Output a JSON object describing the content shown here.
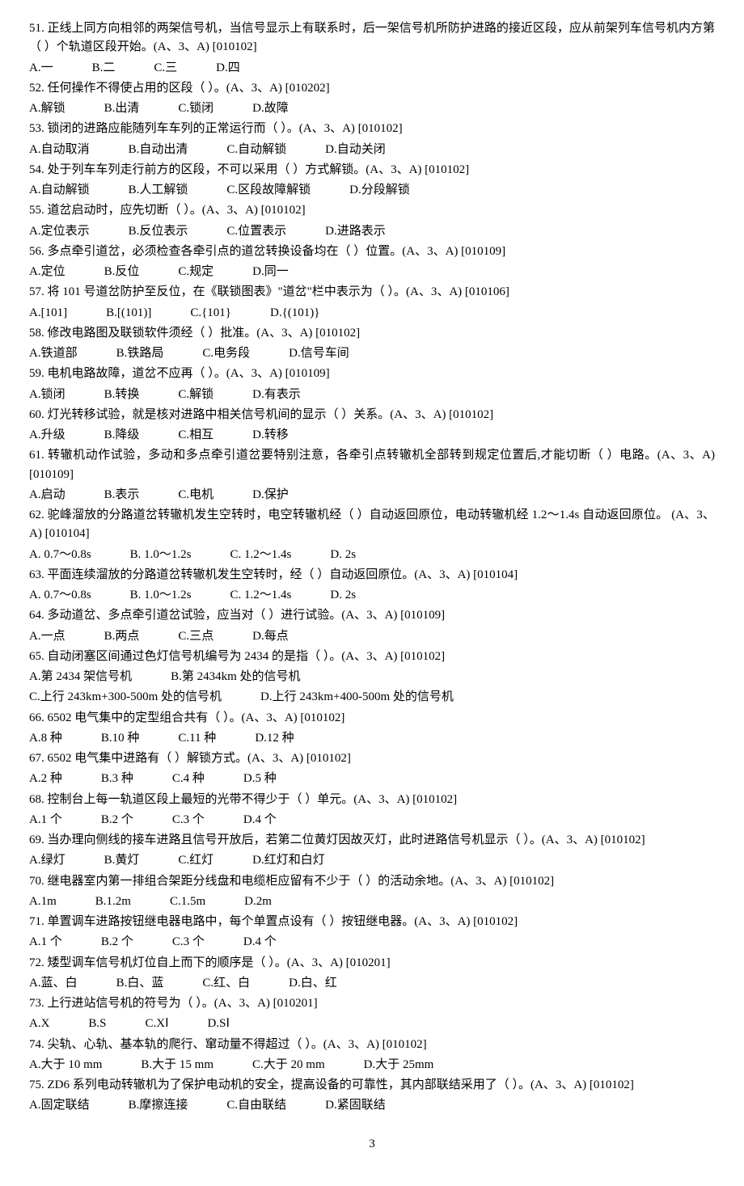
{
  "page_number": "3",
  "questions": [
    {
      "num": "51",
      "text": "正线上同方向相邻的两架信号机，当信号显示上有联系时，后一架信号机所防护进路的接近区段，应从前架列车信号机内方第（    ）个轨道区段开始。(A、3、A)  [010102]",
      "opts": [
        "A.一",
        "B.二",
        "C.三",
        "D.四"
      ]
    },
    {
      "num": "52",
      "text": "任何操作不得使占用的区段（    ）。(A、3、A)  [010202]",
      "opts": [
        "A.解锁",
        "B.出清",
        "C.锁闭",
        "D.故障"
      ]
    },
    {
      "num": "53",
      "text": "锁闭的进路应能随列车车列的正常运行而（    ）。(A、3、A)  [010102]",
      "opts": [
        "A.自动取消",
        "B.自动出清",
        "C.自动解锁",
        "D.自动关闭"
      ]
    },
    {
      "num": "54",
      "text": "处于列车车列走行前方的区段，不可以采用（    ）方式解锁。(A、3、A)  [010102]",
      "opts": [
        "A.自动解锁",
        "B.人工解锁",
        "C.区段故障解锁",
        "D.分段解锁"
      ]
    },
    {
      "num": "55",
      "text": "道岔启动时，应先切断（    ）。(A、3、A)  [010102]",
      "opts": [
        "A.定位表示",
        "B.反位表示",
        "C.位置表示",
        "D.进路表示"
      ]
    },
    {
      "num": "56",
      "text": "多点牵引道岔，必须检查各牵引点的道岔转换设备均在（    ）位置。(A、3、A)  [010109]",
      "opts": [
        "A.定位",
        "B.反位",
        "C.规定",
        "D.同一"
      ]
    },
    {
      "num": "57",
      "text": "将 101 号道岔防护至反位，在《联锁图表》\"道岔\"栏中表示为（    ）。(A、3、A)  [010106]",
      "opts": [
        "A.[101]",
        "B.[(101)]",
        "C.{101}",
        "D.{(101)}"
      ]
    },
    {
      "num": "58",
      "text": "修改电路图及联锁软件须经（    ）批准。(A、3、A)  [010102]",
      "opts": [
        "A.铁道部",
        "B.铁路局",
        "C.电务段",
        "D.信号车间"
      ]
    },
    {
      "num": "59",
      "text": "电机电路故障，道岔不应再（    ）。(A、3、A)  [010109]",
      "opts": [
        "A.锁闭",
        "B.转换",
        "C.解锁",
        "D.有表示"
      ]
    },
    {
      "num": "60",
      "text": "灯光转移试验，就是核对进路中相关信号机间的显示（    ）关系。(A、3、A)  [010102]",
      "opts": [
        "A.升级",
        "B.降级",
        "C.相互",
        "D.转移"
      ]
    },
    {
      "num": "61",
      "text": "转辙机动作试验，多动和多点牵引道岔要特别注意，各牵引点转辙机全部转到规定位置后,才能切断（    ）电路。(A、3、A)  [010109]",
      "opts": [
        "A.启动",
        "B.表示",
        "C.电机",
        "D.保护"
      ]
    },
    {
      "num": "62",
      "text": "驼峰溜放的分路道岔转辙机发生空转时，电空转辙机经（    ）自动返回原位，电动转辙机经 1.2～1.4s 自动返回原位。 (A、3、A)  [010104]",
      "opts": [
        "A. 0.7～0.8s",
        "B. 1.0～1.2s",
        "C. 1.2～1.4s",
        "D. 2s"
      ]
    },
    {
      "num": "63",
      "text": "平面连续溜放的分路道岔转辙机发生空转时，经（    ）自动返回原位。(A、3、A)  [010104]",
      "opts": [
        "A. 0.7～0.8s",
        "B. 1.0～1.2s",
        "C. 1.2～1.4s",
        "D. 2s"
      ]
    },
    {
      "num": "64",
      "text": "多动道岔、多点牵引道岔试验，应当对（    ）进行试验。(A、3、A)  [010109]",
      "opts": [
        "A.一点",
        "B.两点",
        "C.三点",
        "D.每点"
      ]
    },
    {
      "num": "65",
      "text": "自动闭塞区间通过色灯信号机编号为 2434 的是指（    ）。(A、3、A)  [010102]",
      "opts": [
        "A.第 2434 架信号机",
        "B.第 2434km 处的信号机"
      ],
      "opts2": [
        "C.上行 243km+300-500m 处的信号机",
        "D.上行 243km+400-500m 处的信号机"
      ]
    },
    {
      "num": "66",
      "text": "6502 电气集中的定型组合共有（    ）。(A、3、A)  [010102]",
      "opts": [
        "A.8 种",
        "B.10 种",
        "C.11 种",
        "D.12 种"
      ]
    },
    {
      "num": "67",
      "text": "6502 电气集中进路有（    ）解锁方式。(A、3、A)  [010102]",
      "opts": [
        "A.2 种",
        "B.3 种",
        "C.4 种",
        "D.5 种"
      ]
    },
    {
      "num": "68",
      "text": "控制台上每一轨道区段上最短的光带不得少于（    ）单元。(A、3、A)  [010102]",
      "opts": [
        "A.1 个",
        "B.2 个",
        "C.3 个",
        "D.4 个"
      ]
    },
    {
      "num": "69",
      "text": "当办理向侧线的接车进路且信号开放后，若第二位黄灯因故灭灯，此时进路信号机显示（    ）。(A、3、A)  [010102]",
      "opts": [
        "A.绿灯",
        "B.黄灯",
        "C.红灯",
        "D.红灯和白灯"
      ]
    },
    {
      "num": "70",
      "text": "继电器室内第一排组合架距分线盘和电缆柜应留有不少于（    ）的活动余地。(A、3、A)  [010102]",
      "opts": [
        "A.1m",
        "B.1.2m",
        "C.1.5m",
        "D.2m"
      ]
    },
    {
      "num": "71",
      "text": "单置调车进路按钮继电器电路中，每个单置点设有（    ）按钮继电器。(A、3、A)  [010102]",
      "opts": [
        "A.1 个",
        "B.2 个",
        "C.3 个",
        "D.4 个"
      ]
    },
    {
      "num": "72",
      "text": "矮型调车信号机灯位自上而下的顺序是（    ）。(A、3、A)  [010201]",
      "opts": [
        "A.蓝、白",
        "B.白、蓝",
        "C.红、白",
        "D.白、红"
      ]
    },
    {
      "num": "73",
      "text": "上行进站信号机的符号为（    ）。(A、3、A)  [010201]",
      "opts": [
        "A.X",
        "B.S",
        "C.XⅠ",
        "D.SⅠ"
      ]
    },
    {
      "num": "74",
      "text": "尖轨、心轨、基本轨的爬行、窜动量不得超过（    ）。(A、3、A)  [010102]",
      "opts": [
        "A.大于 10 mm",
        "B.大于 15 mm",
        "C.大于 20 mm",
        "D.大于 25mm"
      ]
    },
    {
      "num": "75",
      "text": "ZD6 系列电动转辙机为了保护电动机的安全，提高设备的可靠性，其内部联结采用了（    ）。(A、3、A)  [010102]",
      "opts": [
        "A.固定联结",
        "B.摩擦连接",
        "C.自由联结",
        "D.紧固联结"
      ]
    }
  ]
}
